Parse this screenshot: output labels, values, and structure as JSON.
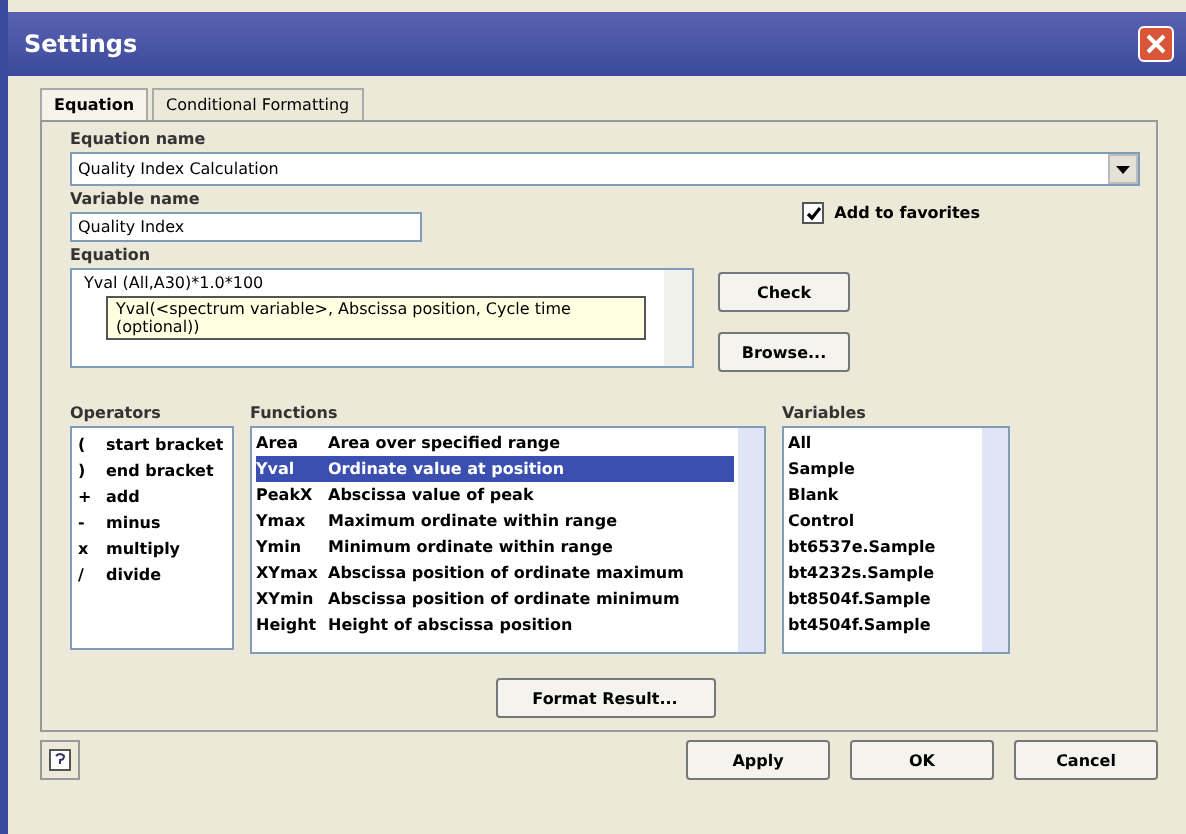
{
  "window": {
    "title": "Settings"
  },
  "tabs": [
    {
      "label": "Equation",
      "selected": true
    },
    {
      "label": "Conditional Formatting",
      "selected": false
    }
  ],
  "equation_name": {
    "label": "Equation name",
    "value": "Quality Index Calculation"
  },
  "variable_name": {
    "label": "Variable name",
    "value": "Quality Index"
  },
  "add_to_favorites": {
    "label": "Add to favorites",
    "checked": true
  },
  "equation": {
    "label": "Equation",
    "value": "Yval (All,A30)*1.0*100",
    "tooltip": "Yval(<spectrum variable>, Abscissa position, Cycle time (optional))"
  },
  "side_buttons": [
    "Check",
    "Browse..."
  ],
  "operators": {
    "label": "Operators",
    "items": [
      {
        "symbol": "(",
        "name": "start bracket"
      },
      {
        "symbol": ")",
        "name": "end bracket"
      },
      {
        "symbol": "+",
        "name": "add"
      },
      {
        "symbol": "-",
        "name": "minus"
      },
      {
        "symbol": "x",
        "name": "multiply"
      },
      {
        "symbol": "/",
        "name": "divide"
      }
    ]
  },
  "functions": {
    "label": "Functions",
    "items": [
      {
        "name": "Area",
        "description": "Area over specified range",
        "selected": false
      },
      {
        "name": "Yval",
        "description": "Ordinate value at position",
        "selected": true
      },
      {
        "name": "PeakX",
        "description": "Abscissa value of peak",
        "selected": false
      },
      {
        "name": "Ymax",
        "description": "Maximum ordinate within range",
        "selected": false
      },
      {
        "name": "Ymin",
        "description": "Minimum ordinate within range",
        "selected": false
      },
      {
        "name": "XYmax",
        "description": "Abscissa position of ordinate maximum",
        "selected": false
      },
      {
        "name": "XYmin",
        "description": "Abscissa position of ordinate minimum",
        "selected": false
      },
      {
        "name": "Height",
        "description": "Height of abscissa position",
        "selected": false
      }
    ]
  },
  "variables": {
    "label": "Variables",
    "items": [
      "All",
      "Sample",
      "Blank",
      "Control",
      "bt6537e.Sample",
      "bt4232s.Sample",
      "bt8504f.Sample",
      "bt4504f.Sample"
    ]
  },
  "format_button": "Format Result...",
  "buttons": [
    "Apply",
    "OK",
    "Cancel"
  ]
}
